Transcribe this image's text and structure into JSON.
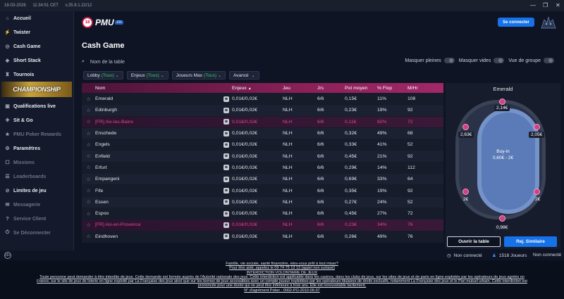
{
  "topbar": {
    "date": "18-03-2026",
    "time": "11:34:51 CET",
    "version": "v.25.9.1.22/12"
  },
  "window": {
    "minimize": "—",
    "restore": "❐",
    "close": "✕"
  },
  "sidebar": {
    "items": [
      {
        "label": "Accueil",
        "icon": "home-icon",
        "glyph": "⌂",
        "dim": false
      },
      {
        "label": "Twister",
        "icon": "bolt-icon",
        "glyph": "⚡",
        "dim": false
      },
      {
        "label": "Cash Game",
        "icon": "coin-icon",
        "glyph": "◎",
        "dim": false
      },
      {
        "label": "Short Stack",
        "icon": "stack-icon",
        "glyph": "◆",
        "dim": false
      },
      {
        "label": "Tournois",
        "icon": "trophy-icon",
        "glyph": "♜",
        "dim": false
      }
    ],
    "banner": "CHAMPIONSHIP",
    "items2": [
      {
        "label": "Qualifications live",
        "icon": "ticket-icon",
        "glyph": "▣",
        "dim": false
      },
      {
        "label": "Sit & Go",
        "icon": "sitgo-icon",
        "glyph": "✚",
        "dim": false
      },
      {
        "label": "PMU Poker Rewards",
        "icon": "reward-icon",
        "glyph": "★",
        "dim": true
      },
      {
        "label": "Paramètres",
        "icon": "gear-icon",
        "glyph": "⚙",
        "dim": false
      },
      {
        "label": "Missions",
        "icon": "mission-icon",
        "glyph": "☐",
        "dim": true
      },
      {
        "label": "Leaderboards",
        "icon": "leaderboard-icon",
        "glyph": "☰",
        "dim": true
      },
      {
        "label": "Limites de jeu",
        "icon": "limit-icon",
        "glyph": "⊘",
        "dim": false
      },
      {
        "label": "Messagerie",
        "icon": "mail-icon",
        "glyph": "✉",
        "dim": true
      },
      {
        "label": "Service Client",
        "icon": "support-icon",
        "glyph": "?",
        "dim": true
      },
      {
        "label": "Se Déconnecter",
        "icon": "logout-icon",
        "glyph": "⏻",
        "dim": true
      }
    ],
    "footer_icon": "18+"
  },
  "header": {
    "logo_number": "18",
    "logo_text": "PMU",
    "logo_fr": ".FR",
    "logo_sub": "POKER",
    "connect": "Se connecter"
  },
  "main": {
    "title": "Cash Game",
    "search_placeholder": "Nom de la table",
    "toggles": [
      "Masquer pleines",
      "Masquer vides",
      "Vue de groupe"
    ],
    "filters": [
      {
        "label": "Lobby",
        "value": "(Tous)"
      },
      {
        "label": "Enjeux",
        "value": "(Tous)"
      },
      {
        "label": "Joueurs Max",
        "value": "(Tous)"
      },
      {
        "label": "Avancé",
        "value": ""
      }
    ]
  },
  "table": {
    "headers": [
      "",
      "Nom",
      "",
      "Enjeux",
      "Jeu",
      "Jrs",
      "Pot moyen",
      "% Flop",
      "M/Hr"
    ],
    "sort_arrow": "▲",
    "rows": [
      {
        "name": "Emerald",
        "stakes": "0,01€/0,02€",
        "game": "NLH",
        "players": "6/6",
        "pot": "0,15€",
        "flop": "11%",
        "mhr": "108",
        "fr": false
      },
      {
        "name": "Edinburgh",
        "stakes": "0,01€/0,02€",
        "game": "NLH",
        "players": "6/6",
        "pot": "0,23€",
        "flop": "19%",
        "mhr": "92",
        "fr": false
      },
      {
        "name": "[FR]  Aix-les-Bains",
        "stakes": "0,01€/0,02€",
        "game": "NLH",
        "players": "6/6",
        "pot": "0,11€",
        "flop": "82%",
        "mhr": "72",
        "fr": true
      },
      {
        "name": "Enschede",
        "stakes": "0,01€/0,02€",
        "game": "NLH",
        "players": "6/6",
        "pot": "0,32€",
        "flop": "49%",
        "mhr": "68",
        "fr": false
      },
      {
        "name": "Engels",
        "stakes": "0,01€/0,02€",
        "game": "NLH",
        "players": "6/6",
        "pot": "0,33€",
        "flop": "41%",
        "mhr": "52",
        "fr": false
      },
      {
        "name": "Enfield",
        "stakes": "0,01€/0,02€",
        "game": "NLH",
        "players": "6/6",
        "pot": "0,45€",
        "flop": "21%",
        "mhr": "92",
        "fr": false
      },
      {
        "name": "Erfurt",
        "stakes": "0,01€/0,02€",
        "game": "NLH",
        "players": "6/6",
        "pot": "0,29€",
        "flop": "14%",
        "mhr": "112",
        "fr": false
      },
      {
        "name": "Empangeni",
        "stakes": "0,01€/0,02€",
        "game": "NLH",
        "players": "6/6",
        "pot": "0,69€",
        "flop": "33%",
        "mhr": "64",
        "fr": false
      },
      {
        "name": "Fife",
        "stakes": "0,01€/0,02€",
        "game": "NLH",
        "players": "6/6",
        "pot": "0,35€",
        "flop": "19%",
        "mhr": "92",
        "fr": false
      },
      {
        "name": "Essen",
        "stakes": "0,01€/0,02€",
        "game": "NLH",
        "players": "6/6",
        "pot": "0,27€",
        "flop": "24%",
        "mhr": "52",
        "fr": false
      },
      {
        "name": "Espoo",
        "stakes": "0,01€/0,02€",
        "game": "NLH",
        "players": "6/6",
        "pot": "0,45€",
        "flop": "27%",
        "mhr": "72",
        "fr": false
      },
      {
        "name": "[FR]  Aix-en-Provence",
        "stakes": "0,01€/0,02€",
        "game": "NLH",
        "players": "6/6",
        "pot": "0,23€",
        "flop": "34%",
        "mhr": "76",
        "fr": true
      },
      {
        "name": "Eindhoven",
        "stakes": "0,01€/0,02€",
        "game": "NLH",
        "players": "6/6",
        "pot": "0,26€",
        "flop": "49%",
        "mhr": "76",
        "fr": false
      }
    ]
  },
  "preview": {
    "name": "Emerald",
    "buyin_label": "Buy-in",
    "buyin_range": "0,60€ - 2€",
    "seats": [
      "2,14€",
      "2,63€",
      "2,05€",
      "2€",
      "2€",
      "0,98€"
    ],
    "open_btn": "Ouvrir la table",
    "join_btn": "Rej. Similaire"
  },
  "status": {
    "left": "Non connecté",
    "players": "1518 Joueurs",
    "right": "Non connecté"
  },
  "footer": {
    "line1": "Famille, vie sociale, santé financière, etes-vous prêt à tout miser?",
    "line2": "Pour être aidé, appelez le 09 74 75 13 13 (appel non surtaxé)",
    "line3": "INTERDICTION VOLONTAIRE DE JEUX",
    "line4": "Toute personne peut demander à être interdite de jeux. Cette demande est formée auprès de l'Autorité nationale des jeux. Cette interdiction est applicable dans les casinos, dans les clubs de jeux, sur les sites de jeux et de paris en ligne exploités par les opérateurs de jeux agréés en",
    "line5": "France, sur le site de jeux de loterie en ligne exploité par La Française des jeux ainsi que sur les bornes de jeux accessibles avec un compte joueur exploitées par les opérateurs titulaires de droits exclusifs, notamment La Française des jeux et le Pari mutuel urbain. Cette interdiction est",
    "line6": "prononcée pour une durée qui ne peut être inférieure à trois ans. Elle est renouvelable tacitement.",
    "line7": "N° d'agrément Poker : 0002-PO-2010-06-07"
  }
}
